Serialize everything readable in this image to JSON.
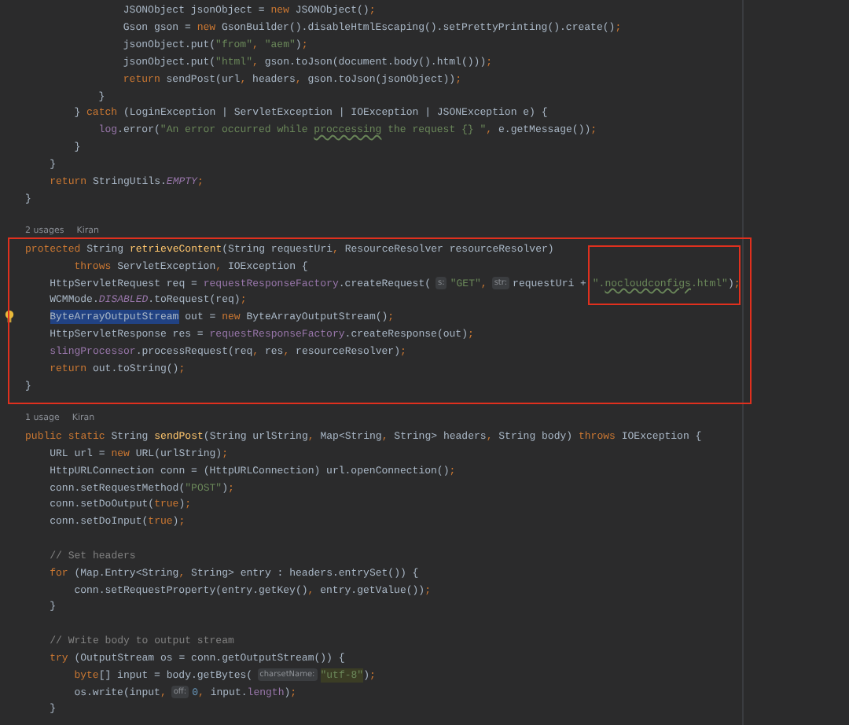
{
  "editor": {
    "lines": [
      {
        "tokens": [
          {
            "kind": "plain",
            "text": "                JSONObject jsonObject = "
          },
          {
            "kind": "kw",
            "text": "new"
          },
          {
            "kind": "plain",
            "text": " JSONObject()"
          },
          {
            "kind": "kw",
            "text": ";"
          }
        ]
      },
      {
        "tokens": [
          {
            "kind": "plain",
            "text": "                Gson gson = "
          },
          {
            "kind": "kw",
            "text": "new"
          },
          {
            "kind": "plain",
            "text": " GsonBuilder().disableHtmlEscaping().setPrettyPrinting().create()"
          },
          {
            "kind": "kw",
            "text": ";"
          }
        ]
      },
      {
        "tokens": [
          {
            "kind": "plain",
            "text": "                jsonObject.put("
          },
          {
            "kind": "str",
            "text": "\"from\""
          },
          {
            "kind": "kw",
            "text": ","
          },
          {
            "kind": "str",
            "text": " \"aem\""
          },
          {
            "kind": "plain",
            "text": ")"
          },
          {
            "kind": "kw",
            "text": ";"
          }
        ]
      },
      {
        "tokens": [
          {
            "kind": "plain",
            "text": "                jsonObject.put("
          },
          {
            "kind": "str",
            "text": "\"html\""
          },
          {
            "kind": "kw",
            "text": ","
          },
          {
            "kind": "plain",
            "text": " gson.toJson(document.body().html()))"
          },
          {
            "kind": "kw",
            "text": ";"
          }
        ]
      },
      {
        "tokens": [
          {
            "kind": "kw",
            "text": "                return"
          },
          {
            "kind": "plain",
            "text": " sendPost(url"
          },
          {
            "kind": "kw",
            "text": ","
          },
          {
            "kind": "plain",
            "text": " headers"
          },
          {
            "kind": "kw",
            "text": ","
          },
          {
            "kind": "plain",
            "text": " gson.toJson(jsonObject))"
          },
          {
            "kind": "kw",
            "text": ";"
          }
        ]
      },
      {
        "tokens": [
          {
            "kind": "plain",
            "text": "            }"
          }
        ]
      },
      {
        "tokens": [
          {
            "kind": "plain",
            "text": "        } "
          },
          {
            "kind": "kw",
            "text": "catch"
          },
          {
            "kind": "plain",
            "text": " (LoginException | ServletException | IOException | JSONException e) {"
          }
        ]
      },
      {
        "tokens": [
          {
            "kind": "field",
            "text": "            log"
          },
          {
            "kind": "plain",
            "text": ".error("
          },
          {
            "kind": "str",
            "text": "\"An error occurred while "
          },
          {
            "kind": "typo",
            "text": "proccessing"
          },
          {
            "kind": "str",
            "text": " the request {} \""
          },
          {
            "kind": "kw",
            "text": ","
          },
          {
            "kind": "plain",
            "text": " e.getMessage())"
          },
          {
            "kind": "kw",
            "text": ";"
          }
        ]
      },
      {
        "tokens": [
          {
            "kind": "plain",
            "text": "        }"
          }
        ]
      },
      {
        "tokens": [
          {
            "kind": "plain",
            "text": "    }"
          }
        ]
      },
      {
        "tokens": [
          {
            "kind": "kw",
            "text": "    return"
          },
          {
            "kind": "plain",
            "text": " StringUtils."
          },
          {
            "kind": "const",
            "text": "EMPTY"
          },
          {
            "kind": "kw",
            "text": ";"
          }
        ]
      },
      {
        "tokens": [
          {
            "kind": "plain",
            "text": "}"
          }
        ]
      },
      {
        "gap_before": true,
        "tokens": [
          {
            "kind": "usage",
            "text": "2 usages"
          },
          {
            "kind": "author",
            "text": "Kiran"
          }
        ]
      },
      {
        "tokens": [
          {
            "kind": "kw",
            "text": "protected"
          },
          {
            "kind": "plain",
            "text": " String "
          },
          {
            "kind": "decl",
            "text": "retrieveContent"
          },
          {
            "kind": "plain",
            "text": "(String requestUri"
          },
          {
            "kind": "kw",
            "text": ","
          },
          {
            "kind": "plain",
            "text": " ResourceResolver resourceResolver)"
          }
        ]
      },
      {
        "tokens": [
          {
            "kind": "kw",
            "text": "        throws"
          },
          {
            "kind": "plain",
            "text": " ServletException"
          },
          {
            "kind": "kw",
            "text": ","
          },
          {
            "kind": "plain",
            "text": " IOException {"
          }
        ]
      },
      {
        "tokens": [
          {
            "kind": "plain",
            "text": "    HttpServletRequest req = "
          },
          {
            "kind": "field",
            "text": "requestResponseFactory"
          },
          {
            "kind": "plain",
            "text": ".createRequest("
          },
          {
            "kind": "hint",
            "text": "s:"
          },
          {
            "kind": "str",
            "text": "\"GET\""
          },
          {
            "kind": "kw",
            "text": ","
          },
          {
            "kind": "hint",
            "text": "str:"
          },
          {
            "kind": "plain",
            "text": "requestUri + "
          },
          {
            "kind": "str",
            "text": "\"."
          },
          {
            "kind": "typo",
            "text": "nocloudconfigs"
          },
          {
            "kind": "str",
            "text": ".html\""
          },
          {
            "kind": "plain",
            "text": ")"
          },
          {
            "kind": "kw",
            "text": ";"
          }
        ]
      },
      {
        "tokens": [
          {
            "kind": "plain",
            "text": "    WCMMode."
          },
          {
            "kind": "const",
            "text": "DISABLED"
          },
          {
            "kind": "plain",
            "text": ".toRequest(req)"
          },
          {
            "kind": "kw",
            "text": ";"
          }
        ]
      },
      {
        "bulb": true,
        "tokens": [
          {
            "kind": "sel",
            "text": "    ByteArrayOutputStream"
          },
          {
            "kind": "plain",
            "text": " out = "
          },
          {
            "kind": "kw",
            "text": "new"
          },
          {
            "kind": "plain",
            "text": " ByteArrayOutputStream()"
          },
          {
            "kind": "kw",
            "text": ";"
          }
        ]
      },
      {
        "tokens": [
          {
            "kind": "plain",
            "text": "    HttpServletResponse res = "
          },
          {
            "kind": "field",
            "text": "requestResponseFactory"
          },
          {
            "kind": "plain",
            "text": ".createResponse(out)"
          },
          {
            "kind": "kw",
            "text": ";"
          }
        ]
      },
      {
        "tokens": [
          {
            "kind": "field",
            "text": "    slingProcessor"
          },
          {
            "kind": "plain",
            "text": ".processRequest(req"
          },
          {
            "kind": "kw",
            "text": ","
          },
          {
            "kind": "plain",
            "text": " res"
          },
          {
            "kind": "kw",
            "text": ","
          },
          {
            "kind": "plain",
            "text": " resourceResolver)"
          },
          {
            "kind": "kw",
            "text": ";"
          }
        ]
      },
      {
        "tokens": [
          {
            "kind": "kw",
            "text": "    return"
          },
          {
            "kind": "plain",
            "text": " out.toString()"
          },
          {
            "kind": "kw",
            "text": ";"
          }
        ]
      },
      {
        "tokens": [
          {
            "kind": "plain",
            "text": "}"
          }
        ]
      },
      {
        "gap_before": true,
        "tokens": [
          {
            "kind": "usage",
            "text": "1 usage"
          },
          {
            "kind": "author",
            "text": "Kiran"
          }
        ]
      },
      {
        "tokens": [
          {
            "kind": "kw",
            "text": "public static"
          },
          {
            "kind": "plain",
            "text": " String "
          },
          {
            "kind": "decl",
            "text": "sendPost"
          },
          {
            "kind": "plain",
            "text": "(String urlString"
          },
          {
            "kind": "kw",
            "text": ","
          },
          {
            "kind": "plain",
            "text": " Map<String"
          },
          {
            "kind": "kw",
            "text": ","
          },
          {
            "kind": "plain",
            "text": " String> headers"
          },
          {
            "kind": "kw",
            "text": ","
          },
          {
            "kind": "plain",
            "text": " String body) "
          },
          {
            "kind": "kw",
            "text": "throws"
          },
          {
            "kind": "plain",
            "text": " IOException {"
          }
        ]
      },
      {
        "tokens": [
          {
            "kind": "plain",
            "text": "    URL url = "
          },
          {
            "kind": "kw",
            "text": "new"
          },
          {
            "kind": "plain",
            "text": " URL(urlString)"
          },
          {
            "kind": "kw",
            "text": ";"
          }
        ]
      },
      {
        "tokens": [
          {
            "kind": "plain",
            "text": "    HttpURLConnection conn = (HttpURLConnection) url.openConnection()"
          },
          {
            "kind": "kw",
            "text": ";"
          }
        ]
      },
      {
        "tokens": [
          {
            "kind": "plain",
            "text": "    conn.setRequestMethod("
          },
          {
            "kind": "str",
            "text": "\"POST\""
          },
          {
            "kind": "plain",
            "text": ")"
          },
          {
            "kind": "kw",
            "text": ";"
          }
        ]
      },
      {
        "tokens": [
          {
            "kind": "plain",
            "text": "    conn.setDoOutput("
          },
          {
            "kind": "kw",
            "text": "true"
          },
          {
            "kind": "plain",
            "text": ")"
          },
          {
            "kind": "kw",
            "text": ";"
          }
        ]
      },
      {
        "tokens": [
          {
            "kind": "plain",
            "text": "    conn.setDoInput("
          },
          {
            "kind": "kw",
            "text": "true"
          },
          {
            "kind": "plain",
            "text": ")"
          },
          {
            "kind": "kw",
            "text": ";"
          }
        ]
      },
      {
        "gap_before": true,
        "tokens": [
          {
            "kind": "comment",
            "text": "    // Set headers"
          }
        ]
      },
      {
        "tokens": [
          {
            "kind": "kw",
            "text": "    for"
          },
          {
            "kind": "plain",
            "text": " (Map.Entry<String"
          },
          {
            "kind": "kw",
            "text": ","
          },
          {
            "kind": "plain",
            "text": " String> entry : headers.entrySet()) {"
          }
        ]
      },
      {
        "tokens": [
          {
            "kind": "plain",
            "text": "        conn.setRequestProperty(entry.getKey()"
          },
          {
            "kind": "kw",
            "text": ","
          },
          {
            "kind": "plain",
            "text": " entry.getValue())"
          },
          {
            "kind": "kw",
            "text": ";"
          }
        ]
      },
      {
        "tokens": [
          {
            "kind": "plain",
            "text": "    }"
          }
        ]
      },
      {
        "gap_before": true,
        "tokens": [
          {
            "kind": "comment",
            "text": "    // Write body to output stream"
          }
        ]
      },
      {
        "tokens": [
          {
            "kind": "kw",
            "text": "    try"
          },
          {
            "kind": "plain",
            "text": " (OutputStream os = conn.getOutputStream()) {"
          }
        ]
      },
      {
        "tokens": [
          {
            "kind": "kw",
            "text": "        byte"
          },
          {
            "kind": "plain",
            "text": "[] input = body.getBytes("
          },
          {
            "kind": "hint",
            "text": "charsetName:"
          },
          {
            "kind": "hl",
            "text": "\"utf-8\""
          },
          {
            "kind": "plain",
            "text": ")"
          },
          {
            "kind": "kw",
            "text": ";"
          }
        ]
      },
      {
        "tokens": [
          {
            "kind": "plain",
            "text": "        os.write(input"
          },
          {
            "kind": "kw",
            "text": ","
          },
          {
            "kind": "hint",
            "text": "off:"
          },
          {
            "kind": "num",
            "text": "0"
          },
          {
            "kind": "kw",
            "text": ","
          },
          {
            "kind": "plain",
            "text": " input."
          },
          {
            "kind": "field",
            "text": "length"
          },
          {
            "kind": "plain",
            "text": ")"
          },
          {
            "kind": "kw",
            "text": ";"
          }
        ]
      },
      {
        "tokens": [
          {
            "kind": "plain",
            "text": "    }"
          }
        ]
      }
    ]
  }
}
